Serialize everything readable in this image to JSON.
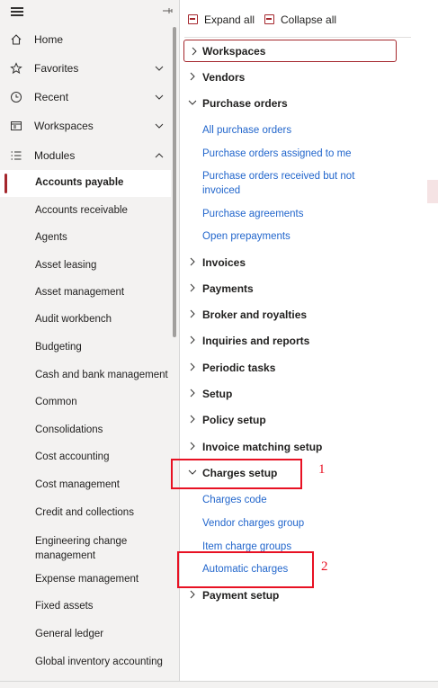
{
  "nav": {
    "top_items": [
      {
        "label": "Home",
        "icon": "home-icon"
      },
      {
        "label": "Favorites",
        "icon": "star-icon"
      },
      {
        "label": "Recent",
        "icon": "clock-icon"
      },
      {
        "label": "Workspaces",
        "icon": "workspace-icon"
      },
      {
        "label": "Modules",
        "icon": "list-icon"
      }
    ],
    "modules": [
      "Accounts payable",
      "Accounts receivable",
      "Agents",
      "Asset leasing",
      "Asset management",
      "Audit workbench",
      "Budgeting",
      "Cash and bank management",
      "Common",
      "Consolidations",
      "Cost accounting",
      "Cost management",
      "Credit and collections",
      "Engineering change management",
      "Expense management",
      "Fixed assets",
      "General ledger",
      "Global inventory accounting"
    ],
    "active_module": "Accounts payable"
  },
  "toolbar": {
    "expand_all": "Expand all",
    "collapse_all": "Collapse all"
  },
  "menu": {
    "workspaces": "Workspaces",
    "vendors": "Vendors",
    "purchase_orders": "Purchase orders",
    "po_links": [
      "All purchase orders",
      "Purchase orders assigned to me",
      "Purchase orders received but not invoiced",
      "Purchase agreements",
      "Open prepayments"
    ],
    "invoices": "Invoices",
    "payments": "Payments",
    "broker": "Broker and royalties",
    "inquiries": "Inquiries and reports",
    "periodic": "Periodic tasks",
    "setup": "Setup",
    "policy": "Policy setup",
    "invoice_matching": "Invoice matching setup",
    "charges_setup": "Charges setup",
    "charges_links": [
      "Charges code",
      "Vendor charges group",
      "Item charge groups",
      "Automatic charges"
    ],
    "payment_setup": "Payment setup"
  },
  "annotations": {
    "callout_1": "1",
    "callout_2": "2"
  },
  "colors": {
    "accent": "#a4262c",
    "link": "#2266cc",
    "callout": "#e81123"
  }
}
